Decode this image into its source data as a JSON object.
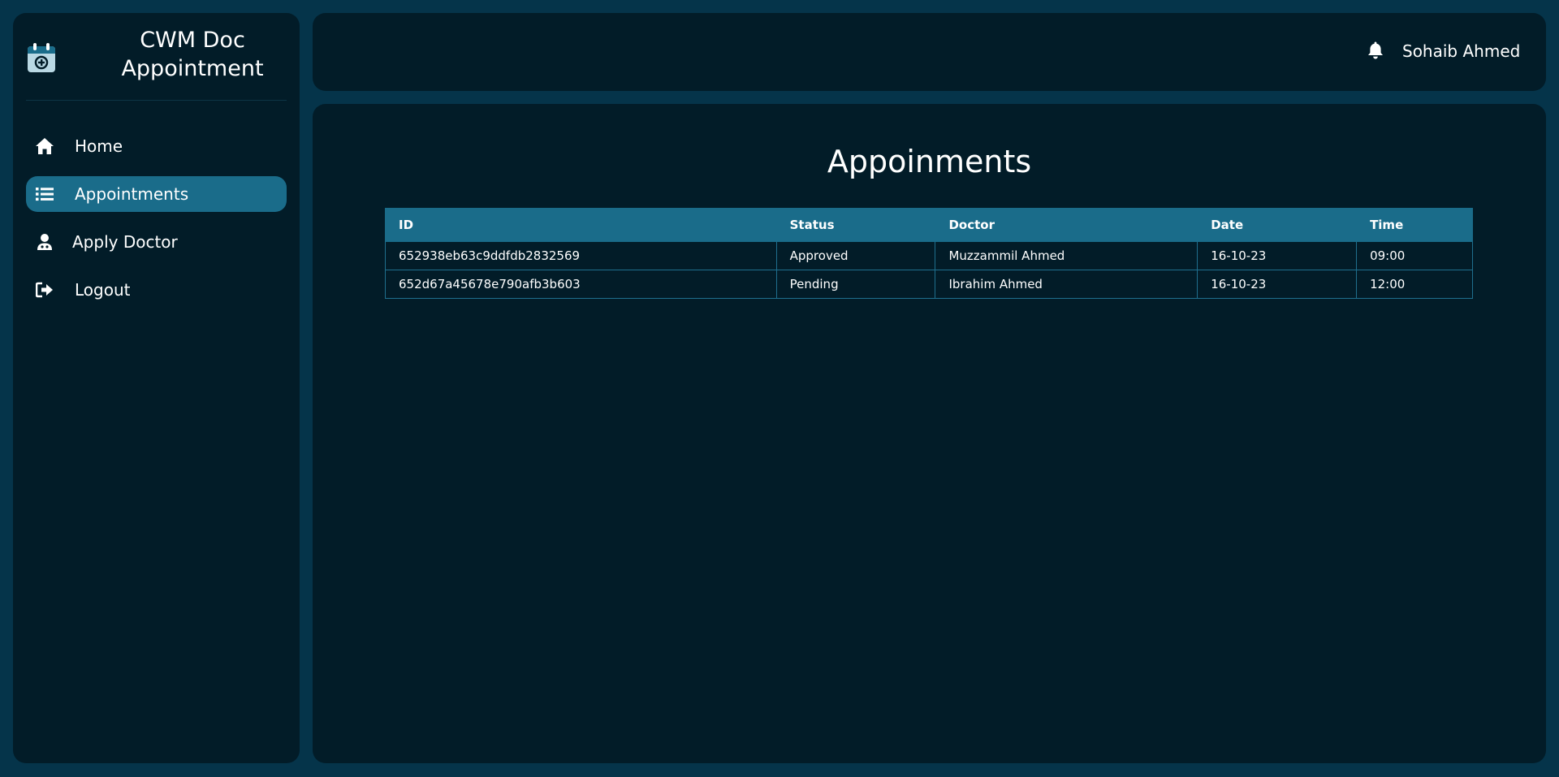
{
  "brand": {
    "title": "CWM Doc Appointment",
    "logo_icon": "calendar-plus-icon"
  },
  "sidebar": {
    "items": [
      {
        "label": "Home",
        "icon": "home-icon",
        "active": false
      },
      {
        "label": "Appointments",
        "icon": "list-icon",
        "active": true
      },
      {
        "label": "Apply Doctor",
        "icon": "user-doctor-icon",
        "active": false
      },
      {
        "label": "Logout",
        "icon": "logout-icon",
        "active": false
      }
    ]
  },
  "header": {
    "user_name": "Sohaib Ahmed",
    "notification_icon": "bell-icon"
  },
  "main": {
    "title": "Appoinments",
    "table": {
      "columns": [
        "ID",
        "Status",
        "Doctor",
        "Date",
        "Time"
      ],
      "rows": [
        [
          "652938eb63c9ddfdb2832569",
          "Approved",
          "Muzzammil Ahmed",
          "16-10-23",
          "09:00"
        ],
        [
          "652d67a45678e790afb3b603",
          "Pending",
          "Ibrahim Ahmed",
          "16-10-23",
          "12:00"
        ]
      ]
    }
  },
  "colors": {
    "background": "#05344a",
    "panel": "#021c28",
    "accent": "#1a6c8a",
    "text": "#ffffff"
  }
}
